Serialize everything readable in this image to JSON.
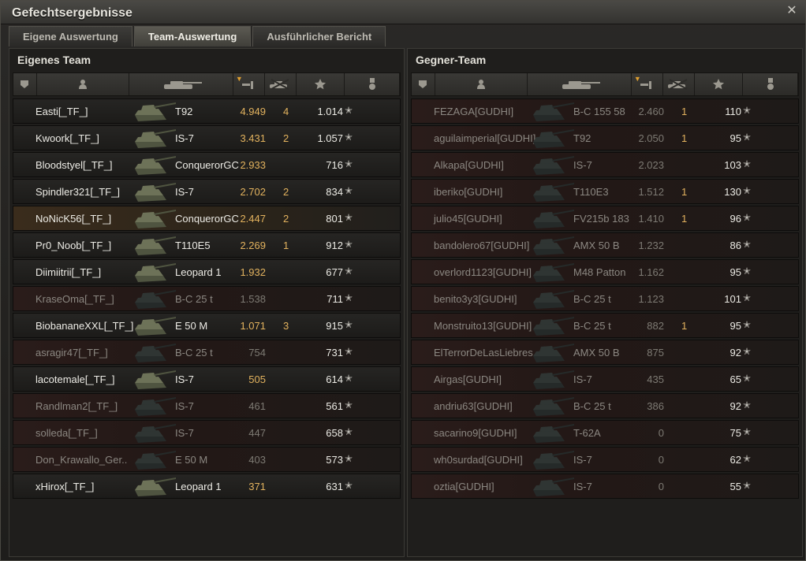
{
  "window": {
    "title": "Gefechtsergebnisse",
    "close_icon": "close-icon"
  },
  "tabs": [
    {
      "label": "Eigene Auswertung",
      "active": false
    },
    {
      "label": "Team-Auswertung",
      "active": true
    },
    {
      "label": "Ausführlicher Bericht",
      "active": false
    }
  ],
  "colors": {
    "accent": "#e2b25e",
    "dead_row": "#2a1c1a",
    "self_row": "#3a2c1c"
  },
  "columns": [
    "squad-icon",
    "player-icon",
    "tank-icon",
    "damage-icon",
    "kills-icon",
    "xp-star-icon",
    "medal-icon"
  ],
  "own_team": {
    "title": "Eigenes Team",
    "rows": [
      {
        "name": "Easti[_TF_]",
        "vehicle": "T92",
        "damage": "4.949",
        "kills": "4",
        "xp": "1.014",
        "dead": false,
        "self": false
      },
      {
        "name": "Kwoork[_TF_]",
        "vehicle": "IS-7",
        "damage": "3.431",
        "kills": "2",
        "xp": "1.057",
        "dead": false,
        "self": false
      },
      {
        "name": "Bloodstyel[_TF_]",
        "vehicle": "ConquerorGC",
        "damage": "2.933",
        "kills": "",
        "xp": "716",
        "dead": false,
        "self": false
      },
      {
        "name": "Spindler321[_TF_]",
        "vehicle": "IS-7",
        "damage": "2.702",
        "kills": "2",
        "xp": "834",
        "dead": false,
        "self": false
      },
      {
        "name": "NoNicK56[_TF_]",
        "vehicle": "ConquerorGC",
        "damage": "2.447",
        "kills": "2",
        "xp": "801",
        "dead": false,
        "self": true
      },
      {
        "name": "Pr0_Noob[_TF_]",
        "vehicle": "T110E5",
        "damage": "2.269",
        "kills": "1",
        "xp": "912",
        "dead": false,
        "self": false
      },
      {
        "name": "Diimiitrii[_TF_]",
        "vehicle": "Leopard 1",
        "damage": "1.932",
        "kills": "",
        "xp": "677",
        "dead": false,
        "self": false
      },
      {
        "name": "KraseOma[_TF_]",
        "vehicle": "B-C 25 t",
        "damage": "1.538",
        "kills": "",
        "xp": "711",
        "dead": true,
        "self": false
      },
      {
        "name": "BiobananeXXL[_TF_]",
        "vehicle": "E 50 M",
        "damage": "1.071",
        "kills": "3",
        "xp": "915",
        "dead": false,
        "self": false
      },
      {
        "name": "asragir47[_TF_]",
        "vehicle": "B-C 25 t",
        "damage": "754",
        "kills": "",
        "xp": "731",
        "dead": true,
        "self": false
      },
      {
        "name": "lacotemale[_TF_]",
        "vehicle": "IS-7",
        "damage": "505",
        "kills": "",
        "xp": "614",
        "dead": false,
        "self": false
      },
      {
        "name": "Randlman2[_TF_]",
        "vehicle": "IS-7",
        "damage": "461",
        "kills": "",
        "xp": "561",
        "dead": true,
        "self": false
      },
      {
        "name": "solleda[_TF_]",
        "vehicle": "IS-7",
        "damage": "447",
        "kills": "",
        "xp": "658",
        "dead": true,
        "self": false
      },
      {
        "name": "Don_Krawallo_Ger..",
        "vehicle": "E 50 M",
        "damage": "403",
        "kills": "",
        "xp": "573",
        "dead": true,
        "self": false
      },
      {
        "name": "xHirox[_TF_]",
        "vehicle": "Leopard 1",
        "damage": "371",
        "kills": "",
        "xp": "631",
        "dead": false,
        "self": false
      }
    ]
  },
  "enemy_team": {
    "title": "Gegner-Team",
    "rows": [
      {
        "name": "FEZAGA[GUDHI]",
        "vehicle": "B-C 155 58",
        "damage": "2.460",
        "kills": "1",
        "xp": "110",
        "dead": true,
        "self": false
      },
      {
        "name": "aguilaimperial[GUDHI]",
        "vehicle": "T92",
        "damage": "2.050",
        "kills": "1",
        "xp": "95",
        "dead": true,
        "self": false
      },
      {
        "name": "Alkapa[GUDHI]",
        "vehicle": "IS-7",
        "damage": "2.023",
        "kills": "",
        "xp": "103",
        "dead": true,
        "self": false
      },
      {
        "name": "iberiko[GUDHI]",
        "vehicle": "T110E3",
        "damage": "1.512",
        "kills": "1",
        "xp": "130",
        "dead": true,
        "self": false
      },
      {
        "name": "julio45[GUDHI]",
        "vehicle": "FV215b 183",
        "damage": "1.410",
        "kills": "1",
        "xp": "96",
        "dead": true,
        "self": false
      },
      {
        "name": "bandolero67[GUDHI]",
        "vehicle": "AMX 50 B",
        "damage": "1.232",
        "kills": "",
        "xp": "86",
        "dead": true,
        "self": false
      },
      {
        "name": "overlord1123[GUDHI]",
        "vehicle": "M48 Patton",
        "damage": "1.162",
        "kills": "",
        "xp": "95",
        "dead": true,
        "self": false
      },
      {
        "name": "benito3y3[GUDHI]",
        "vehicle": "B-C 25 t",
        "damage": "1.123",
        "kills": "",
        "xp": "101",
        "dead": true,
        "self": false
      },
      {
        "name": "Monstruito13[GUDHI]",
        "vehicle": "B-C 25 t",
        "damage": "882",
        "kills": "1",
        "xp": "95",
        "dead": true,
        "self": false
      },
      {
        "name": "ElTerrorDeLasLiebres..",
        "vehicle": "AMX 50 B",
        "damage": "875",
        "kills": "",
        "xp": "92",
        "dead": true,
        "self": false
      },
      {
        "name": "Airgas[GUDHI]",
        "vehicle": "IS-7",
        "damage": "435",
        "kills": "",
        "xp": "65",
        "dead": true,
        "self": false
      },
      {
        "name": "andriu63[GUDHI]",
        "vehicle": "B-C 25 t",
        "damage": "386",
        "kills": "",
        "xp": "92",
        "dead": true,
        "self": false
      },
      {
        "name": "sacarino9[GUDHI]",
        "vehicle": "T-62A",
        "damage": "0",
        "kills": "",
        "xp": "75",
        "dead": true,
        "self": false
      },
      {
        "name": "wh0surdad[GUDHI]",
        "vehicle": "IS-7",
        "damage": "0",
        "kills": "",
        "xp": "62",
        "dead": true,
        "self": false
      },
      {
        "name": "oztia[GUDHI]",
        "vehicle": "IS-7",
        "damage": "0",
        "kills": "",
        "xp": "55",
        "dead": true,
        "self": false
      }
    ]
  }
}
